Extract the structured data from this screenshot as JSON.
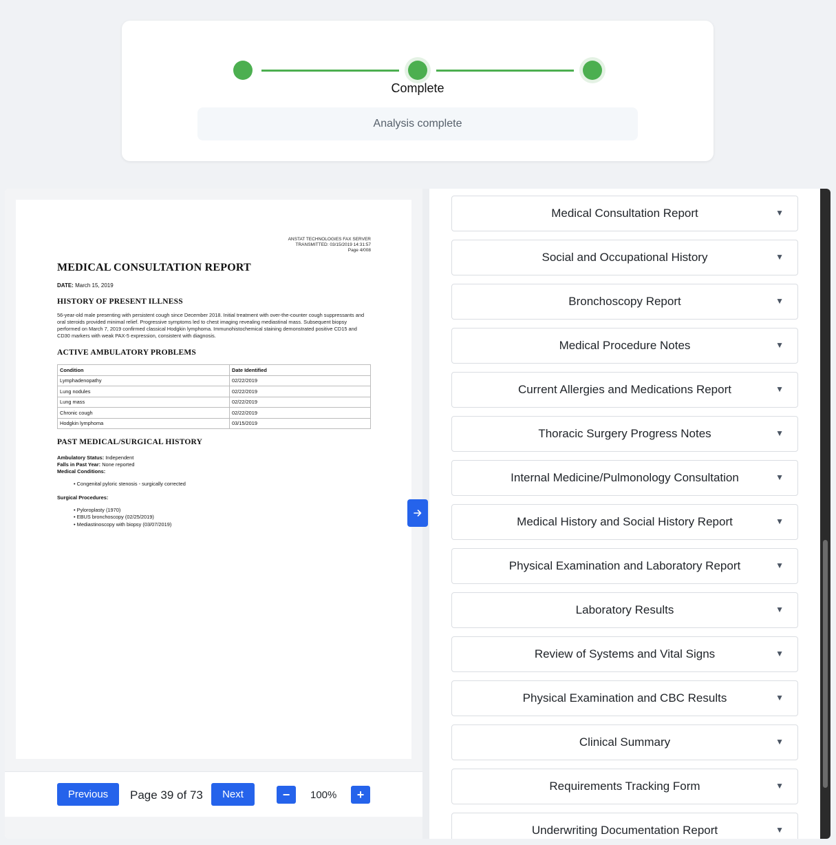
{
  "progress": {
    "steps": 3,
    "status": "Complete",
    "message": "Analysis complete",
    "colors": {
      "step": "#4caf50"
    }
  },
  "viewer": {
    "toggle_icon": "arrow-right-icon",
    "document": {
      "fax_header": [
        "ANSTAT TECHNOLOGIES FAX SERVER",
        "TRANSMITTED: 03/15/2019 14:31:57",
        "Page 4/008"
      ],
      "title": "MEDICAL CONSULTATION REPORT",
      "date_label": "DATE:",
      "date_value": "March 15, 2019",
      "hpi_heading": "HISTORY OF PRESENT ILLNESS",
      "hpi_text": "56-year-old male presenting with persistent cough since December 2018. Initial treatment with over-the-counter cough suppressants and oral steroids provided minimal relief. Progressive symptoms led to chest imaging revealing mediastinal mass. Subsequent biopsy performed on March 7, 2019 confirmed classical Hodgkin lymphoma. Immunohistochemical staining demonstrated positive CD15 and CD30 markers with weak PAX-5 expression, consistent with diagnosis.",
      "problems_heading": "ACTIVE AMBULATORY PROBLEMS",
      "problems_table": {
        "headers": [
          "Condition",
          "Date Identified"
        ],
        "rows": [
          [
            "Lymphadenopathy",
            "02/22/2019"
          ],
          [
            "Lung nodules",
            "02/22/2019"
          ],
          [
            "Lung mass",
            "02/22/2019"
          ],
          [
            "Chronic cough",
            "02/22/2019"
          ],
          [
            "Hodgkin lymphoma",
            "03/15/2019"
          ]
        ]
      },
      "pmh_heading": "PAST MEDICAL/SURGICAL HISTORY",
      "ambulatory_label": "Ambulatory Status:",
      "ambulatory_value": "Independent",
      "falls_label": "Falls in Past Year:",
      "falls_value": "None reported",
      "conditions_label": "Medical Conditions:",
      "conditions": [
        "Congenital pyloric stenosis - surgically corrected"
      ],
      "procedures_label": "Surgical Procedures:",
      "procedures": [
        "Pyloroplasty (1970)",
        "EBUS bronchoscopy (02/25/2019)",
        "Mediastinoscopy with biopsy (03/07/2019)"
      ]
    }
  },
  "pager": {
    "previous_label": "Previous",
    "page_indicator": "Page 39 of 73",
    "next_label": "Next",
    "zoom_out_label": "−",
    "zoom_level": "100%",
    "zoom_in_label": "+"
  },
  "sections": [
    {
      "label": "Medical Consultation Report"
    },
    {
      "label": "Social and Occupational History"
    },
    {
      "label": "Bronchoscopy Report"
    },
    {
      "label": "Medical Procedure Notes"
    },
    {
      "label": "Current Allergies and Medications Report"
    },
    {
      "label": "Thoracic Surgery Progress Notes"
    },
    {
      "label": "Internal Medicine/Pulmonology Consultation"
    },
    {
      "label": "Medical History and Social History Report"
    },
    {
      "label": "Physical Examination and Laboratory Report"
    },
    {
      "label": "Laboratory Results"
    },
    {
      "label": "Review of Systems and Vital Signs"
    },
    {
      "label": "Physical Examination and CBC Results"
    },
    {
      "label": "Clinical Summary"
    },
    {
      "label": "Requirements Tracking Form"
    },
    {
      "label": "Underwriting Documentation Report"
    }
  ],
  "section_caret": "▼",
  "colors": {
    "accent": "#2563eb"
  }
}
